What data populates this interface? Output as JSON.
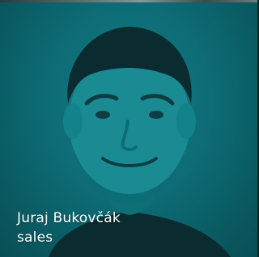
{
  "person": {
    "name": "Juraj Bukovčák",
    "role": "sales"
  },
  "photo": {
    "tint_color": "#0d6c75",
    "icon": "portrait-photo"
  }
}
